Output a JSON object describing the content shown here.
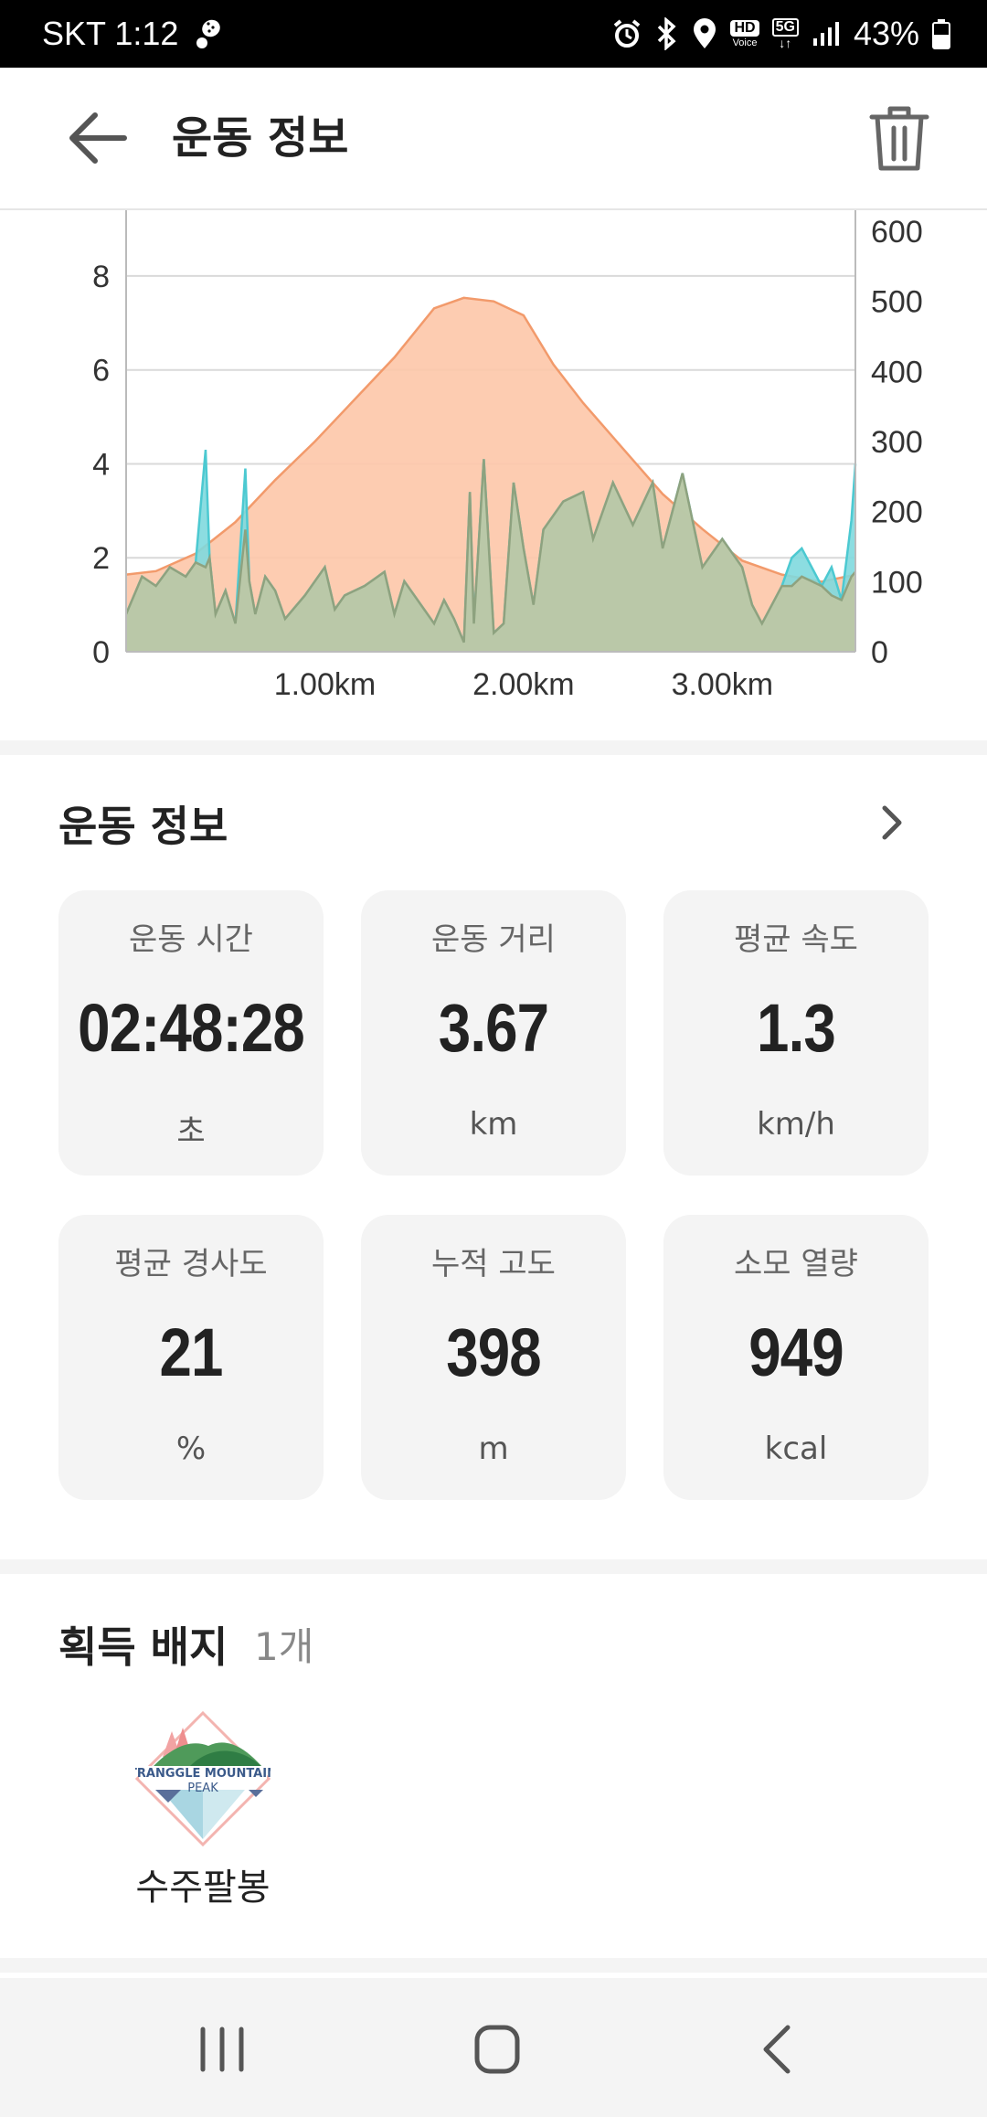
{
  "status_bar": {
    "carrier_time": "SKT 1:12",
    "battery": "43%",
    "hd_voice": "HD",
    "voice_small": "Voice",
    "net": "5G"
  },
  "header": {
    "title": "운동 정보"
  },
  "chart_data": {
    "type": "area",
    "x_tick_labels": [
      "1.00km",
      "2.00km",
      "3.00km"
    ],
    "x_ticks_km": [
      1.0,
      2.0,
      3.0
    ],
    "x_range_km": [
      0,
      3.67
    ],
    "y_left_ticks": [
      "0",
      "2",
      "4",
      "6",
      "8"
    ],
    "y_left_range": [
      0,
      9.4
    ],
    "y_right_ticks": [
      "0",
      "100",
      "200",
      "300",
      "400",
      "500",
      "600"
    ],
    "y_right_range": [
      0,
      630
    ],
    "grid": true,
    "series": [
      {
        "color": "#f29a6b",
        "fill": "#fdc6a9",
        "axis": "right",
        "x": [
          0,
          0.15,
          0.35,
          0.55,
          0.75,
          0.95,
          1.15,
          1.35,
          1.55,
          1.7,
          1.85,
          2.0,
          2.15,
          2.3,
          2.5,
          2.7,
          2.9,
          3.1,
          3.3,
          3.5,
          3.67
        ],
        "values": [
          110,
          115,
          140,
          185,
          245,
          300,
          360,
          420,
          490,
          505,
          500,
          480,
          410,
          355,
          290,
          225,
          175,
          130,
          110,
          100,
          110
        ]
      },
      {
        "color": "#4cc9d1",
        "fill": "#7fd9de",
        "axis": "left",
        "x": [
          0,
          0.08,
          0.15,
          0.22,
          0.3,
          0.35,
          0.4,
          0.42,
          0.45,
          0.5,
          0.55,
          0.6,
          0.62,
          0.65,
          0.7,
          0.75,
          0.8,
          0.9,
          1.0,
          1.05,
          1.1,
          1.2,
          1.3,
          1.35,
          1.4,
          1.5,
          1.55,
          1.6,
          1.65,
          1.7,
          1.73,
          1.75,
          1.8,
          1.85,
          1.9,
          1.95,
          2.0,
          2.05,
          2.1,
          2.2,
          2.3,
          2.35,
          2.45,
          2.55,
          2.65,
          2.7,
          2.8,
          2.9,
          3.0,
          3.1,
          3.15,
          3.2,
          3.3,
          3.35,
          3.4,
          3.5,
          3.55,
          3.6,
          3.65,
          3.67
        ],
        "values": [
          0.8,
          1.6,
          1.4,
          1.8,
          1.6,
          1.9,
          4.3,
          2.0,
          0.8,
          1.3,
          0.6,
          3.9,
          1.5,
          0.8,
          1.6,
          1.3,
          0.7,
          1.2,
          1.8,
          0.9,
          1.2,
          1.4,
          1.7,
          0.8,
          1.5,
          0.9,
          0.6,
          1.1,
          0.7,
          0.2,
          3.4,
          0.6,
          4.1,
          0.4,
          0.6,
          3.6,
          2.2,
          1.0,
          2.6,
          3.2,
          3.4,
          2.4,
          3.6,
          2.7,
          3.6,
          2.2,
          3.8,
          1.8,
          2.4,
          1.8,
          1.0,
          0.6,
          1.4,
          2.0,
          2.2,
          1.4,
          1.8,
          1.1,
          2.8,
          4.0
        ]
      },
      {
        "color": "#8ea27f",
        "fill": "#bfc7a2",
        "axis": "left",
        "x": [
          0,
          0.08,
          0.15,
          0.22,
          0.3,
          0.35,
          0.4,
          0.42,
          0.45,
          0.5,
          0.55,
          0.6,
          0.62,
          0.65,
          0.7,
          0.75,
          0.8,
          0.9,
          1.0,
          1.05,
          1.1,
          1.2,
          1.3,
          1.35,
          1.4,
          1.5,
          1.55,
          1.6,
          1.65,
          1.7,
          1.73,
          1.75,
          1.8,
          1.85,
          1.9,
          1.95,
          2.0,
          2.05,
          2.1,
          2.2,
          2.3,
          2.35,
          2.45,
          2.55,
          2.65,
          2.7,
          2.8,
          2.9,
          3.0,
          3.1,
          3.15,
          3.2,
          3.3,
          3.35,
          3.4,
          3.5,
          3.55,
          3.6,
          3.65,
          3.67
        ],
        "values": [
          0.8,
          1.6,
          1.4,
          1.8,
          1.6,
          1.9,
          1.8,
          2.0,
          0.8,
          1.3,
          0.6,
          2.6,
          1.5,
          0.8,
          1.6,
          1.3,
          0.7,
          1.2,
          1.8,
          0.9,
          1.2,
          1.4,
          1.7,
          0.8,
          1.5,
          0.9,
          0.6,
          1.1,
          0.7,
          0.2,
          3.4,
          0.6,
          4.1,
          0.4,
          0.6,
          3.6,
          2.2,
          1.0,
          2.6,
          3.2,
          3.4,
          2.4,
          3.6,
          2.7,
          3.6,
          2.2,
          3.8,
          1.8,
          2.4,
          1.8,
          1.0,
          0.6,
          1.4,
          1.4,
          1.6,
          1.4,
          1.2,
          1.1,
          1.6,
          1.7
        ]
      }
    ]
  },
  "workout": {
    "title": "운동 정보",
    "stats": [
      {
        "label": "운동 시간",
        "value": "02:48:28",
        "unit": "초"
      },
      {
        "label": "운동 거리",
        "value": "3.67",
        "unit": "km"
      },
      {
        "label": "평균 속도",
        "value": "1.3",
        "unit": "km/h"
      },
      {
        "label": "평균 경사도",
        "value": "21",
        "unit": "%"
      },
      {
        "label": "누적 고도",
        "value": "398",
        "unit": "m"
      },
      {
        "label": "소모 열량",
        "value": "949",
        "unit": "kcal"
      }
    ]
  },
  "badges": {
    "title": "획득 배지",
    "count": "1개",
    "items": [
      {
        "name": "수주팔봉",
        "logo_text_1": "TRANGGLE MOUNTAIN",
        "logo_text_2": "PEAK"
      }
    ]
  }
}
